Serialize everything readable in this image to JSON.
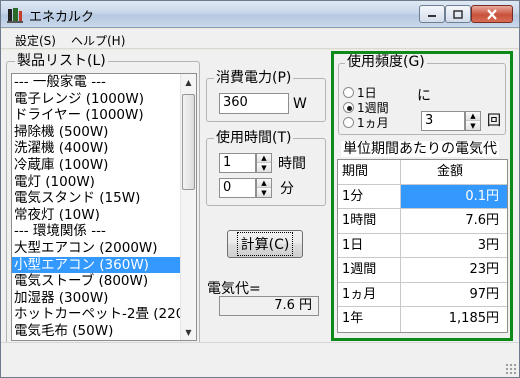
{
  "window": {
    "title": "エネカルク"
  },
  "menu": [
    {
      "label": "設定(S)"
    },
    {
      "label": "ヘルプ(H)"
    }
  ],
  "product_list": {
    "label": "製品リスト(L)",
    "items": [
      "--- 一般家電 ---",
      "電子レンジ (1000W)",
      "ドライヤー (1000W)",
      "掃除機 (500W)",
      "洗濯機 (400W)",
      "冷蔵庫 (100W)",
      "電灯 (100W)",
      "電気スタンド (15W)",
      "常夜灯 (10W)",
      "--- 環境関係 ---",
      "大型エアコン (2000W)",
      "小型エアコン (360W)",
      "電気ストーブ (800W)",
      "加湿器 (300W)",
      "ホットカーペット-2畳 (220",
      "電気毛布 (50W)"
    ],
    "selected_index": 11
  },
  "power": {
    "label": "消費電力(P)",
    "value": "360",
    "unit": "W"
  },
  "usage_time": {
    "label": "使用時間(T)",
    "hours": "1",
    "hours_unit": "時間",
    "minutes": "0",
    "minutes_unit": "分"
  },
  "calc_button": {
    "label": "計算(C)"
  },
  "cost": {
    "label": "電気代=",
    "value": "7.6 円"
  },
  "frequency": {
    "label": "使用頻度(G)",
    "options": [
      "1日",
      "1週間",
      "1ヵ月"
    ],
    "selected_index": 1,
    "ni_label": "に",
    "count": "3",
    "count_unit": "回"
  },
  "period_cost": {
    "label": "単位期間あたりの電気代",
    "headers": {
      "period": "期間",
      "amount": "金額"
    },
    "rows": [
      {
        "period": "1分",
        "amount": "0.1円"
      },
      {
        "period": "1時間",
        "amount": "7.6円"
      },
      {
        "period": "1日",
        "amount": "3円"
      },
      {
        "period": "1週間",
        "amount": "23円"
      },
      {
        "period": "1ヵ月",
        "amount": "97円"
      },
      {
        "period": "1年",
        "amount": "1,185円"
      }
    ],
    "selected_row": 0
  },
  "colors": {
    "highlight": "#3399ff",
    "green_frame": "#0d8a1a"
  }
}
